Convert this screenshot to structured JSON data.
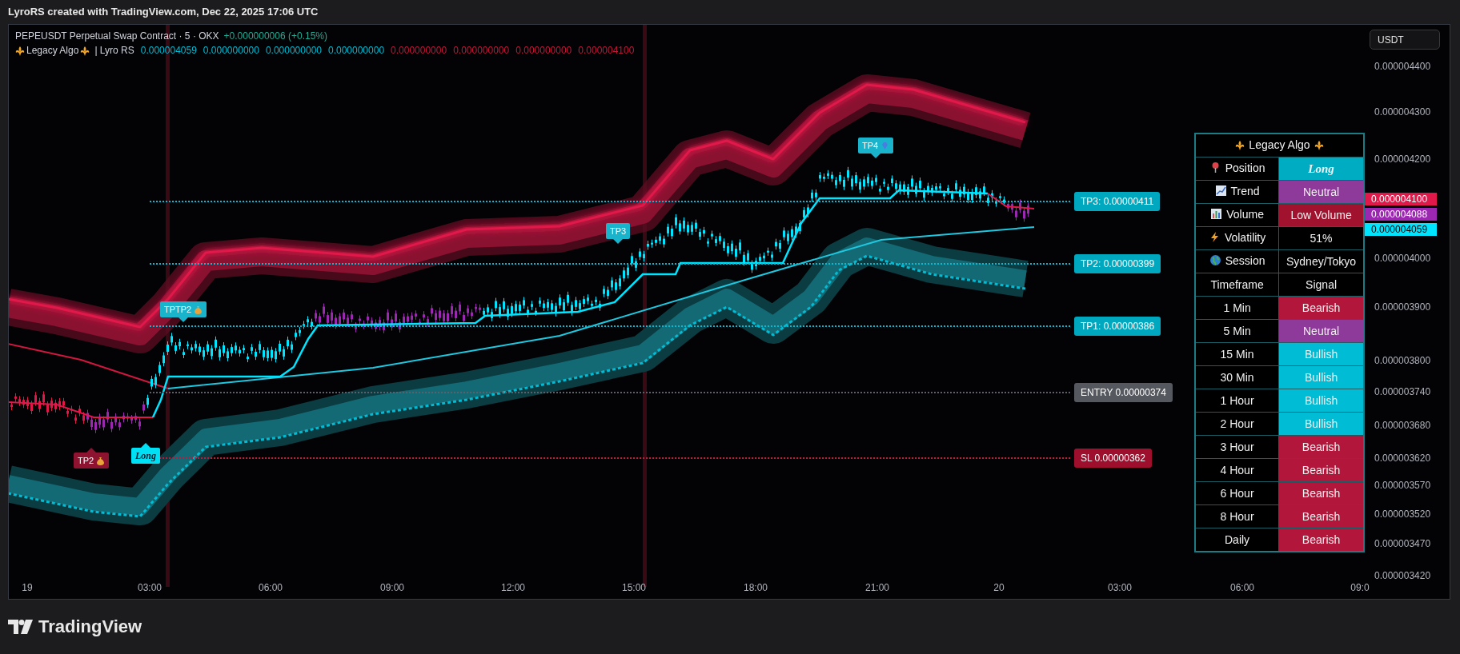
{
  "top_bar": {
    "text": "LyroRS created with TradingView.com, Dec 22, 2025 17:06 UTC"
  },
  "chart": {
    "symbol_line": {
      "title": "PEPEUSDT Perpetual Swap Contract · 5 · OKX",
      "change": "+0.000000006 (+0.15%)"
    },
    "indicator_line": {
      "name": "Legacy Algo",
      "source": "| Lyro RS",
      "values": [
        {
          "text": "0.000004059",
          "color": "#00bcd4"
        },
        {
          "text": "0.000000000",
          "color": "#00bcd4"
        },
        {
          "text": "0.000000000",
          "color": "#00bcd4"
        },
        {
          "text": "0.000000000",
          "color": "#00bcd4"
        },
        {
          "text": "0.000000000",
          "color": "#c2183c"
        },
        {
          "text": "0.000000000",
          "color": "#c2183c"
        },
        {
          "text": "0.000000000",
          "color": "#c2183c"
        },
        {
          "text": "0.000004100",
          "color": "#c2183c"
        }
      ]
    },
    "currency_button": "USDT",
    "price_axis": [
      "0.000004400",
      "0.000004300",
      "0.000004200",
      "0.000004000",
      "0.000003900",
      "0.000003800",
      "0.000003740",
      "0.000003680",
      "0.000003620",
      "0.000003570",
      "0.000003520",
      "0.000003470",
      "0.000003420"
    ],
    "price_tags": [
      {
        "text": "0.000004100",
        "color": "#e0194a"
      },
      {
        "text": "0.000004088",
        "color": "#9c27b0"
      },
      {
        "text": "0.000004059",
        "color": "#00e5ff"
      }
    ],
    "time_axis": [
      "19",
      "03:00",
      "06:00",
      "09:00",
      "12:00",
      "15:00",
      "18:00",
      "21:00",
      "20",
      "03:00",
      "06:00",
      "09:0"
    ],
    "levels": [
      {
        "kind": "tp",
        "label": "TP3: 0.00000411"
      },
      {
        "kind": "tp",
        "label": "TP2: 0.00000399"
      },
      {
        "kind": "tp",
        "label": "TP1: 0.00000386"
      },
      {
        "kind": "entry",
        "label": "ENTRY 0.00000374"
      },
      {
        "kind": "sl",
        "label": "SL 0.00000362"
      }
    ],
    "markers": [
      {
        "kind": "bearish",
        "text": "TP2"
      },
      {
        "kind": "long",
        "text": "Long"
      },
      {
        "kind": "bullish",
        "text": "TPTP2"
      },
      {
        "kind": "bullish",
        "text": "TP3"
      },
      {
        "kind": "bullish",
        "text": "TP4"
      }
    ],
    "table": {
      "title": "Legacy Algo",
      "rows": [
        {
          "kind": "metric",
          "label": "Position",
          "value": "Long",
          "color": "#00acc1"
        },
        {
          "kind": "metric",
          "label": "Trend",
          "value": "Neutral",
          "color": "#8e3a9b"
        },
        {
          "kind": "metric",
          "label": "Volume",
          "value": "Low Volume",
          "color": "#a0122e"
        },
        {
          "kind": "metric",
          "label": "Volatility",
          "value": "51%",
          "color": "#000000"
        },
        {
          "kind": "metric",
          "label": "Session",
          "value": "Sydney/Tokyo",
          "color": "#000000"
        },
        {
          "kind": "header",
          "label": "Timeframe",
          "value": "Signal",
          "color": "#000000"
        },
        {
          "kind": "signal",
          "label": "1 Min",
          "value": "Bearish",
          "color": "#b2163a"
        },
        {
          "kind": "signal",
          "label": "5 Min",
          "value": "Neutral",
          "color": "#8e3a9b"
        },
        {
          "kind": "signal",
          "label": "15 Min",
          "value": "Bullish",
          "color": "#00bcd4"
        },
        {
          "kind": "signal",
          "label": "30 Min",
          "value": "Bullish",
          "color": "#00bcd4"
        },
        {
          "kind": "signal",
          "label": "1 Hour",
          "value": "Bullish",
          "color": "#00bcd4"
        },
        {
          "kind": "signal",
          "label": "2 Hour",
          "value": "Bullish",
          "color": "#00bcd4"
        },
        {
          "kind": "signal",
          "label": "3 Hour",
          "value": "Bearish",
          "color": "#b2163a"
        },
        {
          "kind": "signal",
          "label": "4 Hour",
          "value": "Bearish",
          "color": "#b2163a"
        },
        {
          "kind": "signal",
          "label": "6 Hour",
          "value": "Bearish",
          "color": "#b2163a"
        },
        {
          "kind": "signal",
          "label": "8 Hour",
          "value": "Bearish",
          "color": "#b2163a"
        },
        {
          "kind": "signal",
          "label": "Daily",
          "value": "Bearish",
          "color": "#b2163a"
        }
      ]
    }
  },
  "footer": {
    "logo": "TradingView"
  }
}
